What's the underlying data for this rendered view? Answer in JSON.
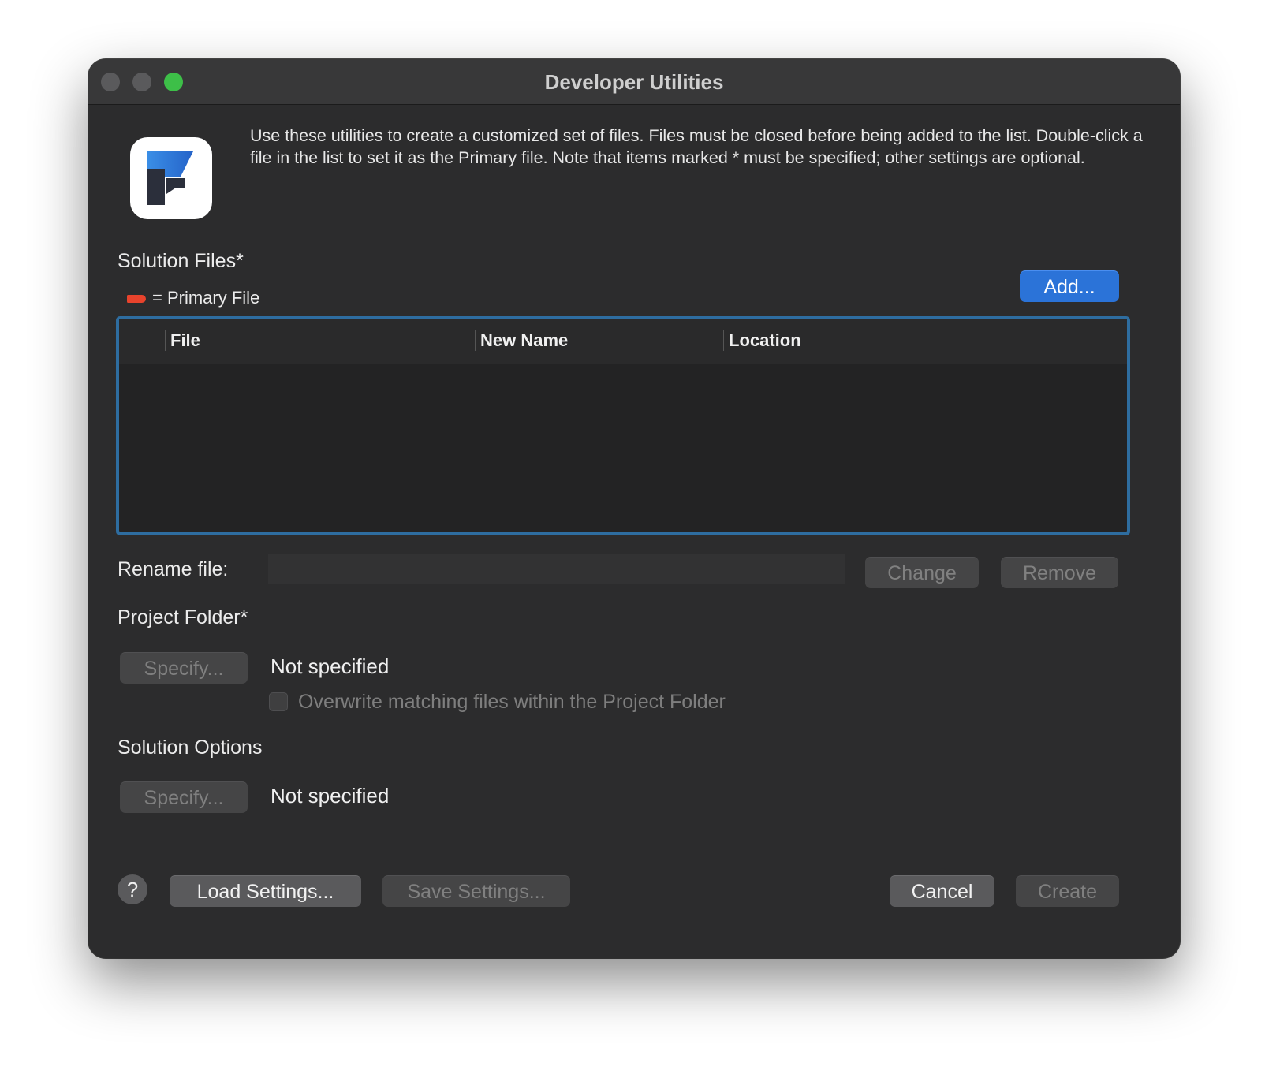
{
  "window": {
    "title": "Developer Utilities"
  },
  "intro": {
    "text": "Use these utilities to create a customized set of files. Files must be closed before being added to the list. Double-click a file in the list to set it as the Primary file. Note that items marked * must be specified; other settings are optional."
  },
  "solution_files": {
    "label": "Solution Files*",
    "legend": "= Primary File",
    "add_label": "Add...",
    "columns": [
      "File",
      "New Name",
      "Location"
    ]
  },
  "rename": {
    "label": "Rename file:",
    "value": "",
    "change_label": "Change",
    "remove_label": "Remove"
  },
  "project_folder": {
    "label": "Project Folder*",
    "specify_label": "Specify...",
    "status": "Not specified",
    "overwrite_label": "Overwrite matching files within the Project Folder",
    "overwrite_checked": false
  },
  "solution_options": {
    "label": "Solution Options",
    "specify_label": "Specify...",
    "status": "Not specified"
  },
  "footer": {
    "help_label": "?",
    "load_label": "Load Settings...",
    "save_label": "Save Settings...",
    "cancel_label": "Cancel",
    "create_label": "Create"
  },
  "colors": {
    "accent": "#2b73d8",
    "focus_ring": "#2e6da0",
    "primary_marker": "#e8432c"
  }
}
